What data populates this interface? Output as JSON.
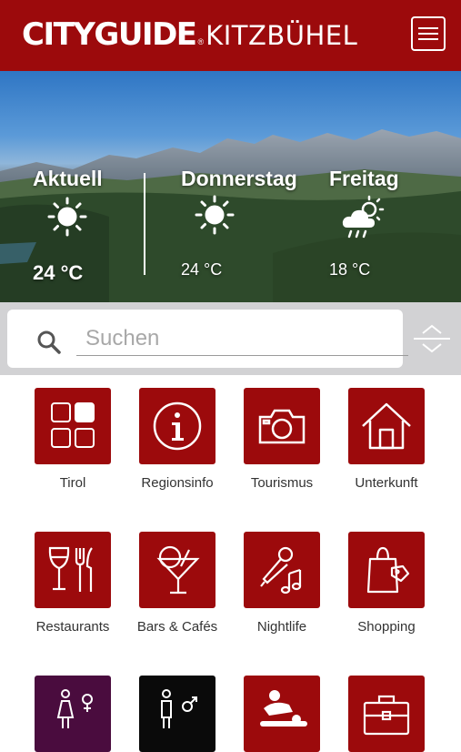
{
  "header": {
    "logo_brand": "CITYGUIDE",
    "logo_reg": "®",
    "logo_city": "KITZBÜHEL",
    "menu_icon": "hamburger-menu-icon",
    "bg_color": "#9c0a0c"
  },
  "weather": {
    "current": {
      "label": "Aktuell",
      "icon": "sun-icon",
      "temp": "24 °C"
    },
    "day1": {
      "label": "Donnerstag",
      "icon": "sun-icon",
      "temp": "24 °C"
    },
    "day2": {
      "label": "Freitag",
      "icon": "cloud-sun-rain-icon",
      "temp": "18 °C"
    }
  },
  "search": {
    "placeholder": "Suchen",
    "icon": "search-icon",
    "sort_icon": "chevron-up-down-icon"
  },
  "categories": [
    {
      "label": "Tirol",
      "icon": "tiles-icon",
      "color": "#9c0a0c"
    },
    {
      "label": "Regionsinfo",
      "icon": "info-icon",
      "color": "#9c0a0c"
    },
    {
      "label": "Tourismus",
      "icon": "camera-icon",
      "color": "#9c0a0c"
    },
    {
      "label": "Unterkunft",
      "icon": "house-icon",
      "color": "#9c0a0c"
    },
    {
      "label": "Restaurants",
      "icon": "wine-cutlery-icon",
      "color": "#9c0a0c"
    },
    {
      "label": "Bars & Cafés",
      "icon": "cocktail-icon",
      "color": "#9c0a0c"
    },
    {
      "label": "Nightlife",
      "icon": "microphone-music-icon",
      "color": "#9c0a0c"
    },
    {
      "label": "Shopping",
      "icon": "shopping-bag-icon",
      "color": "#9c0a0c"
    },
    {
      "label": "",
      "icon": "female-icon",
      "color": "#4a0c3e"
    },
    {
      "label": "",
      "icon": "male-icon",
      "color": "#0a0a0a"
    },
    {
      "label": "",
      "icon": "massage-icon",
      "color": "#9c0a0c"
    },
    {
      "label": "",
      "icon": "briefcase-icon",
      "color": "#9c0a0c"
    }
  ]
}
